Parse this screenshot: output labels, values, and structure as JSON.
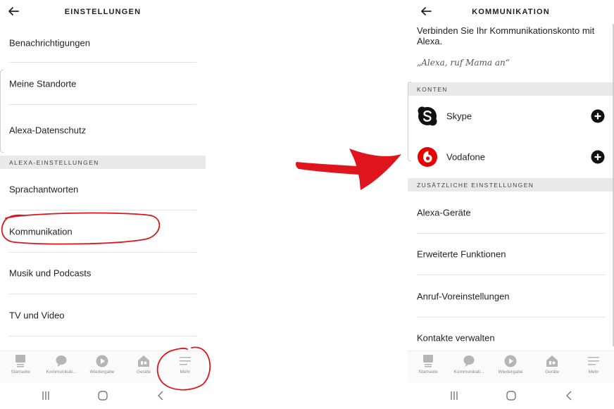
{
  "left": {
    "title": "EINSTELLUNGEN",
    "items_top": [
      "Benachrichtigungen",
      "Meine Standorte",
      "Alexa-Datenschutz"
    ],
    "section": "ALEXA-EINSTELLUNGEN",
    "items_bottom": [
      "Sprachantworten",
      "Kommunikation",
      "Musik und Podcasts",
      "TV und Video"
    ]
  },
  "right": {
    "title": "KOMMUNIKATION",
    "intro": "Verbinden Sie Ihr Kommunikationskonto mit Alexa.",
    "quote": "„Alexa, ruf Mama an“",
    "accounts_section": "KONTEN",
    "accounts": [
      {
        "name": "Skype",
        "icon": "skype-icon"
      },
      {
        "name": "Vodafone",
        "icon": "vodafone-icon"
      }
    ],
    "extra_section": "ZUSÄTZLICHE EINSTELLUNGEN",
    "items": [
      "Alexa-Geräte",
      "Erweiterte Funktionen",
      "Anruf-Voreinstellungen",
      "Kontakte verwalten"
    ]
  },
  "nav": [
    "Startseite",
    "Kommunikati...",
    "Wiedergabe",
    "Geräte",
    "Mehr"
  ],
  "colors": {
    "annotation": "#e0141c",
    "skype": "#111111",
    "vodafone": "#e60000",
    "nav_icon": "#b5b5b5",
    "section_bg": "#e9e9e9"
  }
}
